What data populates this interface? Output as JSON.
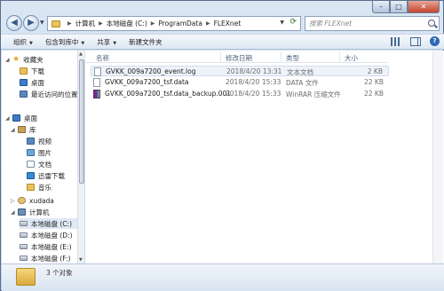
{
  "window": {
    "controls": {
      "minimize": "–",
      "maximize": "□",
      "close": "✕"
    }
  },
  "address": {
    "crumbs": [
      "计算机",
      "本地磁盘 (C:)",
      "ProgramData",
      "FLEXnet"
    ],
    "search_placeholder": "搜索 FLEXnet"
  },
  "toolbar": {
    "items": [
      "组织",
      "包含到库中",
      "共享",
      "新建文件夹"
    ]
  },
  "nav": {
    "favorites": {
      "label": "收藏夹",
      "items": [
        "下载",
        "桌面",
        "最近访问的位置"
      ]
    },
    "desktop": "桌面",
    "library": {
      "label": "库",
      "items": [
        "视频",
        "图片",
        "文档",
        "迅雷下载",
        "音乐"
      ]
    },
    "user": "xudada",
    "computer": {
      "label": "计算机",
      "drives": [
        "本地磁盘 (C:)",
        "本地磁盘 (D:)",
        "本地磁盘 (E:)",
        "本地磁盘 (F:)"
      ]
    }
  },
  "columns": {
    "name": "名称",
    "date": "修改日期",
    "type": "类型",
    "size": "大小"
  },
  "files": [
    {
      "name": "GVKK_009a7200_event.log",
      "date": "2018/4/20 13:31",
      "type": "文本文档",
      "size": "2 KB",
      "icon": "log-file-icon"
    },
    {
      "name": "GVKK_009a7200_tsf.data",
      "date": "2018/4/20 15:33",
      "type": "DATA 文件",
      "size": "22 KB",
      "icon": "data-file-icon"
    },
    {
      "name": "GVKK_009a7200_tsf.data_backup.001",
      "date": "2018/4/20 15:33",
      "type": "WinRAR 压缩文件",
      "size": "22 KB",
      "icon": "rar-archive-icon"
    }
  ],
  "details": {
    "count_text": "3 个对象"
  }
}
